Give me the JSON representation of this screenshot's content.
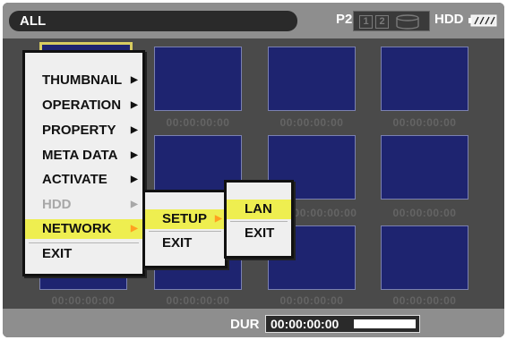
{
  "top_bar": {
    "filter_label": "ALL",
    "media_label": "P2",
    "slot1": "1",
    "slot2": "2",
    "storage_label": "HDD"
  },
  "thumbnails": {
    "timecode": "00:00:00:00"
  },
  "main_menu": {
    "items": [
      {
        "label": "THUMBNAIL",
        "has_submenu": true,
        "state": "normal"
      },
      {
        "label": "OPERATION",
        "has_submenu": true,
        "state": "normal"
      },
      {
        "label": "PROPERTY",
        "has_submenu": true,
        "state": "normal"
      },
      {
        "label": "META DATA",
        "has_submenu": true,
        "state": "normal"
      },
      {
        "label": "ACTIVATE",
        "has_submenu": true,
        "state": "normal"
      },
      {
        "label": "HDD",
        "has_submenu": true,
        "state": "disabled"
      },
      {
        "label": "NETWORK",
        "has_submenu": true,
        "state": "selected"
      },
      {
        "label": "EXIT",
        "has_submenu": false,
        "state": "normal"
      }
    ]
  },
  "network_menu": {
    "items": [
      {
        "label": "SETUP",
        "has_submenu": true,
        "state": "selected"
      },
      {
        "label": "EXIT",
        "has_submenu": false,
        "state": "normal"
      }
    ]
  },
  "setup_menu": {
    "items": [
      {
        "label": "LAN",
        "has_submenu": false,
        "state": "selected"
      },
      {
        "label": "EXIT",
        "has_submenu": false,
        "state": "normal"
      }
    ]
  },
  "bottom_bar": {
    "dur_label": "DUR",
    "dur_value": "00:00:00:00",
    "dur_progress": 1.0
  },
  "colors": {
    "highlight": "#eeee50",
    "arrow_selected": "#ffa020",
    "thumbnail_fill": "#1e2470",
    "selection_border": "#d8cc60"
  }
}
